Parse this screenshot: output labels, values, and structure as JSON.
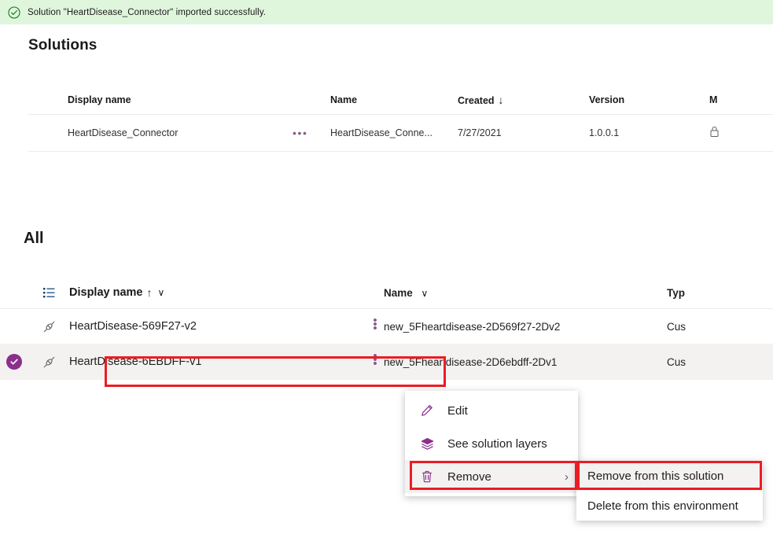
{
  "banner": {
    "icon": "success-check-circle-icon",
    "message": "Solution \"HeartDisease_Connector\" imported successfully.",
    "background": "#dff6dd"
  },
  "page": {
    "title": "Solutions"
  },
  "solutions_table": {
    "columns": [
      "Display name",
      "Name",
      "Created",
      "Version",
      "M"
    ],
    "sort": {
      "column": "Created",
      "direction": "descending",
      "glyph": "↓"
    },
    "rows": [
      {
        "display_name": "HeartDisease_Connector",
        "overflow": "•••",
        "name": "HeartDisease_Conne...",
        "created": "7/27/2021",
        "version": "1.0.0.1",
        "managed": "managed-icon"
      }
    ]
  },
  "all_section": {
    "title": "All",
    "columns": {
      "list_icon": "list-view-icon",
      "display_name": "Display name",
      "display_name_sort_glyph": "↑",
      "display_name_chevron": "∨",
      "name": "Name",
      "name_chevron": "∨",
      "type": "Typ"
    },
    "rows": [
      {
        "selected": false,
        "check": "",
        "type_icon": "connector-icon",
        "display_name": "HeartDisease-569F27-v2",
        "kebab": "kebab-menu-icon",
        "name": "new_5Fheartdisease-2D569f27-2Dv2",
        "type": "Cus"
      },
      {
        "selected": true,
        "check": "✓",
        "type_icon": "connector-icon",
        "display_name": "HeartDisease-6EBDFF-v1",
        "kebab": "kebab-menu-icon",
        "name": "new_5Fheartdisease-2D6ebdff-2Dv1",
        "type": "Cus"
      }
    ]
  },
  "context_menu": {
    "items": [
      {
        "icon": "pencil-edit-icon",
        "label": "Edit",
        "highlighted": false,
        "has_submenu": false
      },
      {
        "icon": "layers-icon",
        "label": "See solution layers",
        "highlighted": false,
        "has_submenu": false
      },
      {
        "icon": "trash-can-icon",
        "label": "Remove",
        "highlighted": true,
        "has_submenu": true,
        "chevron": "›"
      }
    ]
  },
  "submenu": {
    "items": [
      {
        "label": "Remove from this solution",
        "highlighted": true
      },
      {
        "label": "Delete from this environment",
        "highlighted": false
      }
    ]
  },
  "annotations": {
    "highlight_color": "#ec1c24",
    "boxes": [
      "selected-row-display-name",
      "remove-menu-item",
      "remove-from-this-solution-item"
    ]
  },
  "colors": {
    "accent_purple": "#8c2f8c",
    "banner_green": "#dff6dd",
    "row_selected_gray": "#f3f2f1"
  }
}
